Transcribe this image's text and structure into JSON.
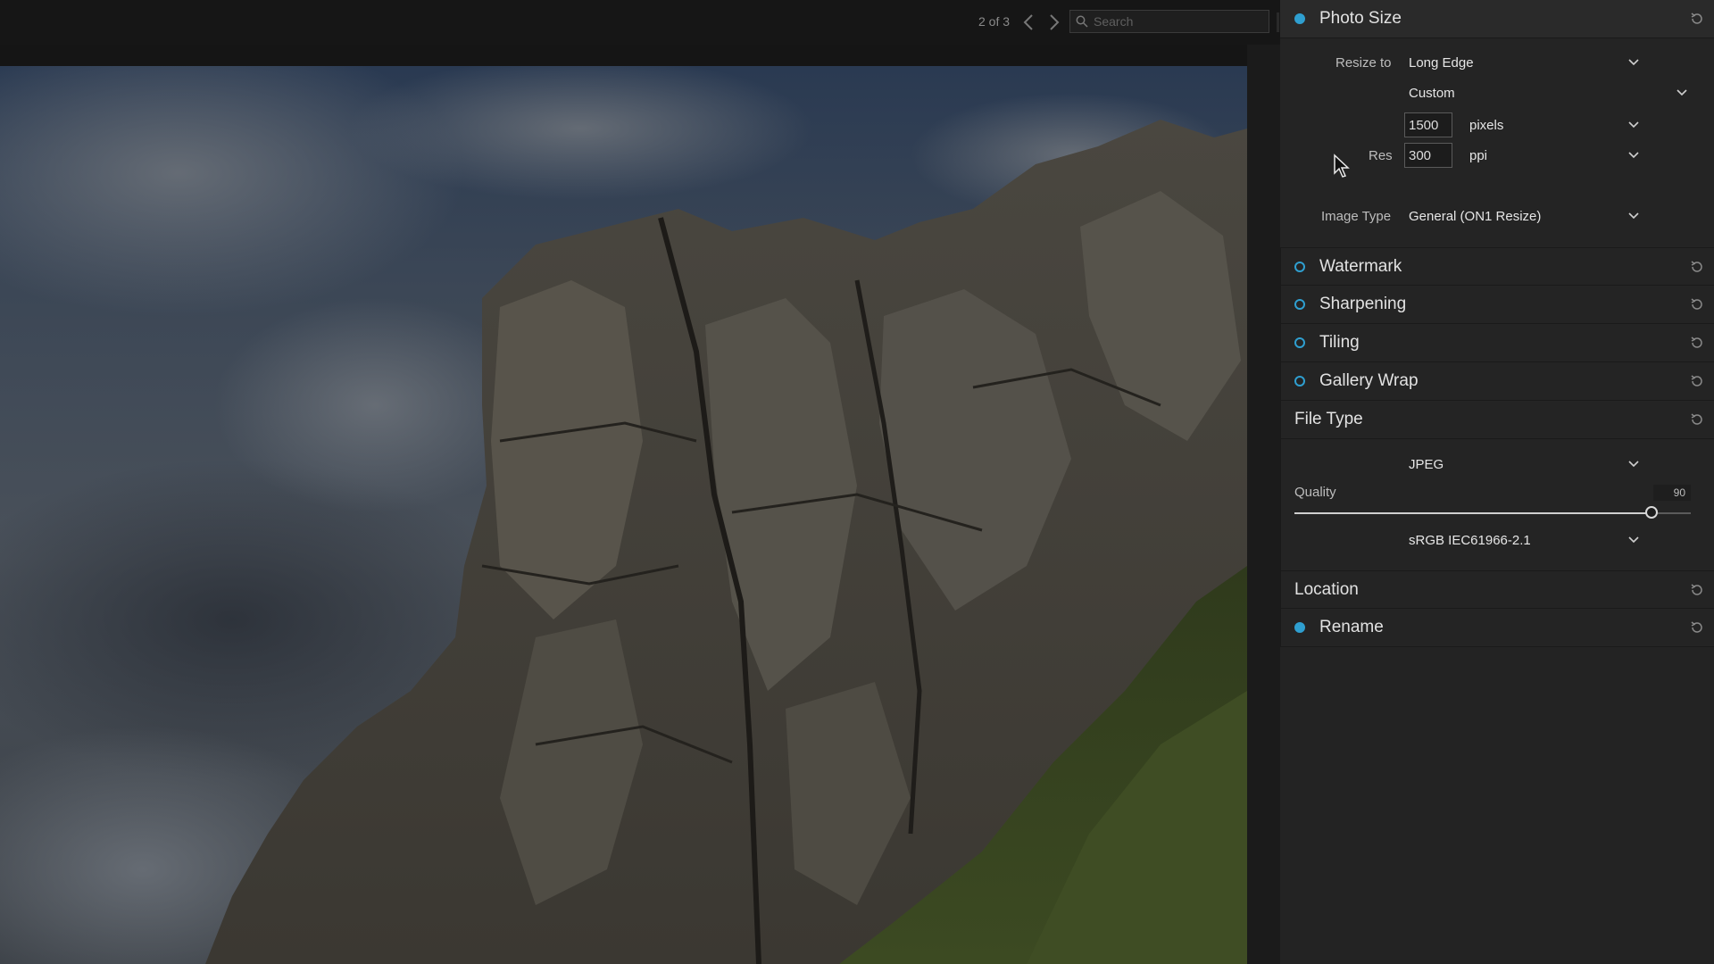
{
  "topbar": {
    "page_counter": "2 of 3",
    "search_placeholder": "Search"
  },
  "panel": {
    "photo_size": {
      "title": "Photo Size",
      "enabled": true,
      "resize_label": "Resize to",
      "resize_value": "Long Edge",
      "preset_value": "Custom",
      "size_value": "1500",
      "size_unit": "pixels",
      "res_label": "Res",
      "res_value": "300",
      "res_unit": "ppi",
      "image_type_label": "Image Type",
      "image_type_value": "General (ON1 Resize)"
    },
    "watermark": {
      "title": "Watermark",
      "enabled": false
    },
    "sharpening": {
      "title": "Sharpening",
      "enabled": false
    },
    "tiling": {
      "title": "Tiling",
      "enabled": false
    },
    "gallery_wrap": {
      "title": "Gallery Wrap",
      "enabled": false
    },
    "file_type": {
      "title": "File Type",
      "format_value": "JPEG",
      "quality_label": "Quality",
      "quality_value": "90",
      "quality_fraction": 0.9,
      "color_profile": "sRGB IEC61966-2.1"
    },
    "location": {
      "title": "Location"
    },
    "rename": {
      "title": "Rename",
      "enabled": true
    }
  },
  "colors": {
    "accent": "#2f9fd0",
    "panel_bg": "#242424",
    "app_bg": "#151515"
  }
}
